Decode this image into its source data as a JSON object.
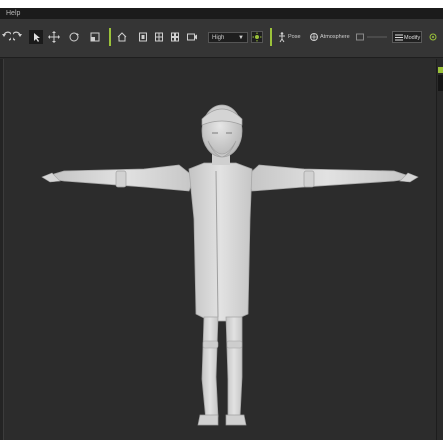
{
  "menubar": {
    "label": "Help"
  },
  "toolbar": {
    "quality_value": "High",
    "pose_label": "Pose",
    "atmosphere_label": "Atmosphere",
    "modify_label": "Modify"
  },
  "icons": [
    "undo-icon",
    "redo-icon",
    "select-icon",
    "move-icon",
    "rotate-icon",
    "scale-icon",
    "home-icon",
    "view-front-icon",
    "view-grid-icon",
    "view-quad-icon",
    "camera-icon",
    "light-icon",
    "pose-icon",
    "atmosphere-icon",
    "modify-icon"
  ],
  "colors": {
    "accent": "#9bc23a",
    "viewport_bg": "#2c2c2c",
    "toolbar_bg": "#353535",
    "model": "#d8d8d8"
  }
}
